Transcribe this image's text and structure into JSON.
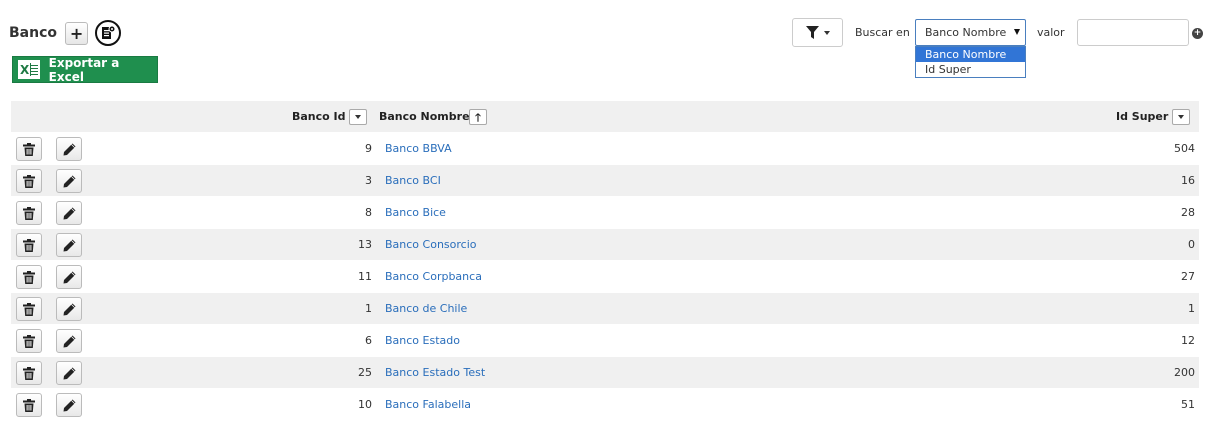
{
  "header": {
    "title": "Banco"
  },
  "toolbar": {
    "add_label": "+",
    "excel_label": "Exportar a Excel",
    "excel_icon_letter": "X"
  },
  "search": {
    "buscar_label": "Buscar en",
    "selected": "Banco Nombre",
    "options": [
      "Banco Nombre",
      "Id Super"
    ],
    "valor_label": "valor",
    "value": "",
    "add_label": "+"
  },
  "table": {
    "columns": {
      "id": "Banco Id",
      "name": "Banco Nombre",
      "super": "Id Super"
    },
    "rows": [
      {
        "id": "9",
        "name": "Banco BBVA",
        "super": "504"
      },
      {
        "id": "3",
        "name": "Banco BCI",
        "super": "16"
      },
      {
        "id": "8",
        "name": "Banco Bice",
        "super": "28"
      },
      {
        "id": "13",
        "name": "Banco Consorcio",
        "super": "0"
      },
      {
        "id": "11",
        "name": "Banco Corpbanca",
        "super": "27"
      },
      {
        "id": "1",
        "name": "Banco de Chile",
        "super": "1"
      },
      {
        "id": "6",
        "name": "Banco Estado",
        "super": "12"
      },
      {
        "id": "25",
        "name": "Banco Estado Test",
        "super": "200"
      },
      {
        "id": "10",
        "name": "Banco Falabella",
        "super": "51"
      }
    ]
  },
  "colors": {
    "link": "#2a6ebb",
    "excel_green": "#1f8f4e",
    "row_alt": "#f0f0f0",
    "select_highlight": "#3175d6"
  }
}
